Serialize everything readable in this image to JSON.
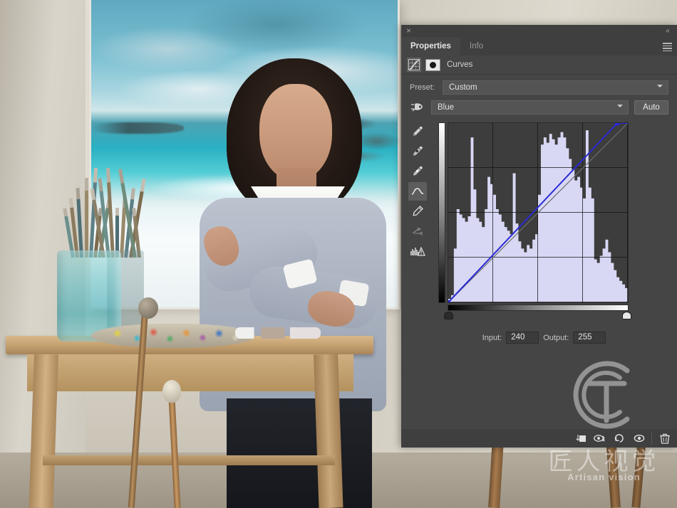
{
  "panel": {
    "titlebar": {
      "close_icon": "close-icon",
      "collapse_icon": "double-chevron-right-icon",
      "close_glyph": "×",
      "collapse_glyph": "«"
    },
    "tabs": [
      {
        "label": "Properties",
        "active": true
      },
      {
        "label": "Info",
        "active": false
      }
    ],
    "menu_icon": "panel-menu-icon",
    "adjustment": {
      "icon": "curves-adjustment-icon",
      "mask_icon": "layer-mask-thumbnail",
      "title": "Curves"
    },
    "preset": {
      "label": "Preset:",
      "value": "Custom",
      "chevron_icon": "chevron-down-icon"
    },
    "channel": {
      "on_image_tool_icon": "on-image-adjustment-icon",
      "value": "Blue",
      "chevron_icon": "chevron-down-icon",
      "auto_label": "Auto"
    },
    "tools": [
      {
        "name": "sample-in-image-eyedropper",
        "icon": "eyedropper-icon",
        "active": false
      },
      {
        "name": "black-point-eyedropper",
        "icon": "eyedropper-black-icon",
        "active": false
      },
      {
        "name": "white-point-eyedropper",
        "icon": "eyedropper-white-icon",
        "active": false
      },
      {
        "name": "edit-points-curve-tool",
        "icon": "curve-icon",
        "active": true
      },
      {
        "name": "draw-curve-pencil-tool",
        "icon": "pencil-icon",
        "active": false
      },
      {
        "name": "smooth-curve-tool",
        "icon": "smooth-curve-icon",
        "active": false
      },
      {
        "name": "histogram-clipping-warning",
        "icon": "histogram-warning-icon",
        "active": false
      }
    ],
    "io": {
      "input_label": "Input:",
      "input_value": "240",
      "output_label": "Output:",
      "output_value": "255"
    },
    "sliders": {
      "black_point": "black-point-slider",
      "white_point": "white-point-slider"
    },
    "bottom_buttons": [
      {
        "name": "clip-to-layer-button",
        "icon": "clip-to-layer-icon"
      },
      {
        "name": "view-previous-state-button",
        "icon": "eye-rotate-icon"
      },
      {
        "name": "reset-adjustment-button",
        "icon": "reset-arrow-icon"
      },
      {
        "name": "toggle-layer-visibility-button",
        "icon": "eye-icon"
      },
      {
        "name": "delete-adjustment-layer-button",
        "icon": "trash-icon"
      }
    ],
    "colors": {
      "panel_bg": "#454545",
      "panel_bar": "#3f3f3f",
      "graph_bg": "#3d3d3d",
      "curve_blue": "#2a2ad6",
      "histogram_fill": "#d8d8f5",
      "text": "#c8c8c8"
    }
  },
  "watermark": {
    "logo_icon": "artisan-c-t-monogram",
    "chinese": "匠人视觉",
    "english": "Artisan vision"
  },
  "chart_data": {
    "type": "line",
    "title": "Curves — Blue channel",
    "xlabel": "Input",
    "ylabel": "Output",
    "xlim": [
      0,
      255
    ],
    "ylim": [
      0,
      255
    ],
    "grid": true,
    "grid_divisions": 4,
    "legend": "none",
    "curve_points": [
      {
        "input": 0,
        "output": 0
      },
      {
        "input": 240,
        "output": 255
      }
    ],
    "selected_point": {
      "input": 240,
      "output": 255
    },
    "baseline": {
      "from": [
        0,
        0
      ],
      "to": [
        255,
        255
      ]
    },
    "histogram": {
      "bins": 64,
      "values": [
        2,
        4,
        30,
        52,
        49,
        47,
        45,
        48,
        92,
        63,
        47,
        45,
        42,
        52,
        70,
        66,
        60,
        52,
        49,
        45,
        42,
        40,
        38,
        72,
        44,
        34,
        30,
        28,
        32,
        30,
        35,
        38,
        60,
        88,
        92,
        89,
        94,
        91,
        88,
        92,
        95,
        92,
        86,
        80,
        74,
        68,
        70,
        64,
        58,
        96,
        64,
        58,
        24,
        22,
        26,
        30,
        35,
        28,
        22,
        18,
        14,
        12,
        10,
        8
      ]
    }
  }
}
